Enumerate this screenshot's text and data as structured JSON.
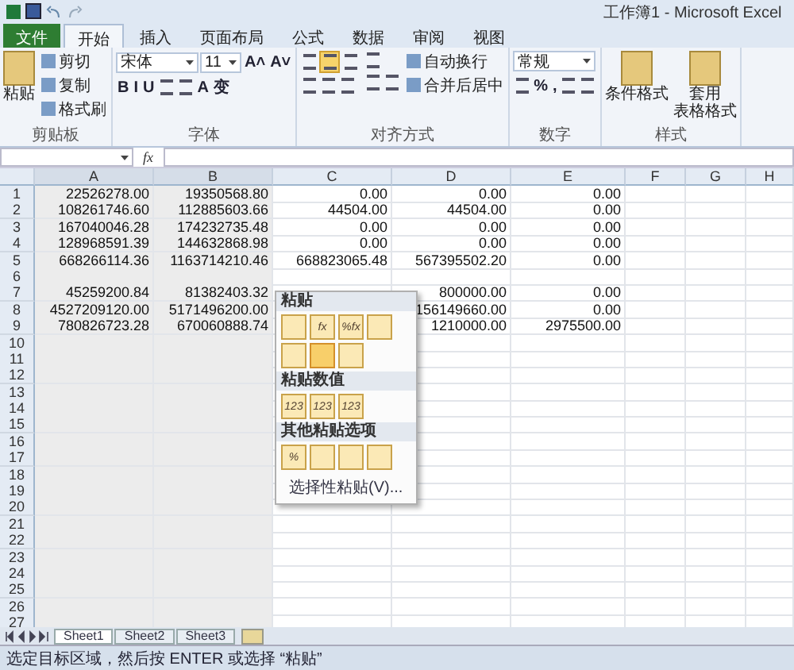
{
  "window": {
    "title": "工作簿1 - Microsoft Excel"
  },
  "ribbon_tabs": [
    {
      "label": "文件",
      "kind": "file",
      "selected": false
    },
    {
      "label": "开始",
      "kind": "tab",
      "selected": true
    },
    {
      "label": "插入",
      "kind": "tab",
      "selected": false
    },
    {
      "label": "页面布局",
      "kind": "tab",
      "selected": false
    },
    {
      "label": "公式",
      "kind": "tab",
      "selected": false
    },
    {
      "label": "数据",
      "kind": "tab",
      "selected": false
    },
    {
      "label": "审阅",
      "kind": "tab",
      "selected": false
    },
    {
      "label": "视图",
      "kind": "tab",
      "selected": false
    }
  ],
  "ribbon_groups": [
    {
      "label": "剪贴板",
      "columns": [
        [
          [
            {
              "kind": "big",
              "lines": [
                "粘贴"
              ]
            }
          ]
        ],
        [
          [
            {
              "kind": "small",
              "label": "剪切"
            }
          ],
          [
            {
              "kind": "small",
              "label": "复制"
            }
          ],
          [
            {
              "kind": "small",
              "label": "格式刷"
            }
          ]
        ]
      ]
    },
    {
      "label": "字体",
      "columns": [
        [
          [
            {
              "kind": "wide_dropdown",
              "value": "宋体"
            },
            {
              "kind": "dropdown",
              "value": "11"
            },
            {
              "kind": "glyph",
              "text": "A˄"
            },
            {
              "kind": "glyph",
              "text": "A˅"
            }
          ],
          [
            {
              "kind": "glyph",
              "text": "B"
            },
            {
              "kind": "glyph",
              "text": "I"
            },
            {
              "kind": "glyph",
              "text": "U"
            },
            {
              "kind": "icon"
            },
            {
              "kind": "icon"
            },
            {
              "kind": "glyph",
              "text": "A"
            },
            {
              "kind": "glyph",
              "text": "变"
            }
          ]
        ]
      ]
    },
    {
      "label": "对齐方式",
      "columns": [
        [
          [
            {
              "kind": "icon",
              "selected": false
            },
            {
              "kind": "icon",
              "selected": true
            },
            {
              "kind": "icon",
              "selected": false
            }
          ],
          [
            {
              "kind": "icon",
              "selected": false
            },
            {
              "kind": "icon",
              "selected": false
            },
            {
              "kind": "icon",
              "selected": false
            }
          ]
        ],
        [
          [
            {
              "kind": "icon"
            }
          ],
          [
            {
              "kind": "icon"
            },
            {
              "kind": "icon"
            }
          ]
        ],
        [
          [
            {
              "kind": "small",
              "label": "自动换行"
            }
          ],
          [
            {
              "kind": "small",
              "label": "合并后居中"
            }
          ]
        ]
      ]
    },
    {
      "label": "数字",
      "columns": [
        [
          [
            {
              "kind": "wide_dropdown",
              "value": "常规"
            }
          ],
          [
            {
              "kind": "icon"
            },
            {
              "kind": "glyph",
              "text": "%"
            },
            {
              "kind": "glyph",
              "text": ","
            },
            {
              "kind": "icon"
            },
            {
              "kind": "icon"
            }
          ]
        ]
      ]
    },
    {
      "label": "样式",
      "columns": [
        [
          [
            {
              "kind": "big",
              "lines": [
                "条件格式"
              ]
            }
          ]
        ],
        [
          [
            {
              "kind": "big",
              "lines": [
                "套用",
                "表格格式"
              ]
            }
          ]
        ]
      ]
    }
  ],
  "formula_bar": {
    "function_label": "fx"
  },
  "columns": [
    {
      "label": "A",
      "selected": true
    },
    {
      "label": "B",
      "selected": true
    },
    {
      "label": "C",
      "selected": false
    },
    {
      "label": "D",
      "selected": false
    },
    {
      "label": "E",
      "selected": false
    },
    {
      "label": "F",
      "selected": false
    },
    {
      "label": "G",
      "selected": false
    },
    {
      "label": "H",
      "selected": false
    }
  ],
  "rows": [
    {
      "number": "1",
      "cells": [
        "22526278.00",
        "19350568.80",
        "0.00",
        "0.00",
        "0.00"
      ]
    },
    {
      "number": "2",
      "cells": [
        "108261746.60",
        "112885603.66",
        "44504.00",
        "44504.00",
        "0.00"
      ]
    },
    {
      "number": "3",
      "cells": [
        "167040046.28",
        "174232735.48",
        "0.00",
        "0.00",
        "0.00"
      ]
    },
    {
      "number": "4",
      "cells": [
        "128968591.39",
        "144632868.98",
        "0.00",
        "0.00",
        "0.00"
      ]
    },
    {
      "number": "5",
      "cells": [
        "668266114.36",
        "1163714210.46",
        "668823065.48",
        "567395502.20",
        "0.00"
      ]
    },
    {
      "number": "6"
    },
    {
      "number": "7",
      "cells": [
        "45259200.84",
        "81382403.32",
        null,
        "800000.00",
        "0.00"
      ]
    },
    {
      "number": "8",
      "cells": [
        "4527209120.00",
        "5171496200.00",
        null,
        "156149660.00",
        "0.00"
      ]
    },
    {
      "number": "9",
      "cells": [
        "780826723.28",
        "670060888.74",
        null,
        "1210000.00",
        "2975500.00"
      ]
    },
    {
      "number": "10"
    },
    {
      "number": "11"
    },
    {
      "number": "12"
    },
    {
      "number": "13"
    },
    {
      "number": "14"
    },
    {
      "number": "15"
    },
    {
      "number": "16"
    },
    {
      "number": "17"
    },
    {
      "number": "18"
    },
    {
      "number": "19"
    },
    {
      "number": "20"
    },
    {
      "number": "21"
    },
    {
      "number": "22"
    },
    {
      "number": "23"
    },
    {
      "number": "24"
    },
    {
      "number": "25"
    },
    {
      "number": "26"
    },
    {
      "number": "27"
    }
  ],
  "paste_menu": {
    "sections": [
      {
        "title": "粘贴",
        "options": [
          {
            "highlighted": false
          },
          {
            "label": "fx",
            "highlighted": false
          },
          {
            "label": "%fx",
            "highlighted": false
          },
          {
            "highlighted": false
          },
          {
            "highlighted": false
          },
          {
            "highlighted": true
          },
          {
            "highlighted": false
          }
        ]
      },
      {
        "title": "粘贴数值",
        "options": [
          {
            "label": "123",
            "highlighted": false
          },
          {
            "label": "123",
            "highlighted": false
          },
          {
            "label": "123",
            "highlighted": false
          }
        ]
      },
      {
        "title": "其他粘贴选项",
        "options": [
          {
            "label": "%",
            "highlighted": false
          },
          {
            "highlighted": false
          },
          {
            "highlighted": false
          },
          {
            "highlighted": false
          }
        ]
      }
    ],
    "link": "选择性粘贴(V)..."
  },
  "sheet_tabs": [
    {
      "label": "Sheet1",
      "selected": true
    },
    {
      "label": "Sheet2",
      "selected": false
    },
    {
      "label": "Sheet3",
      "selected": false
    }
  ],
  "status_bar": {
    "text": "选定目标区域，然后按 ENTER 或选择 “粘贴”"
  }
}
